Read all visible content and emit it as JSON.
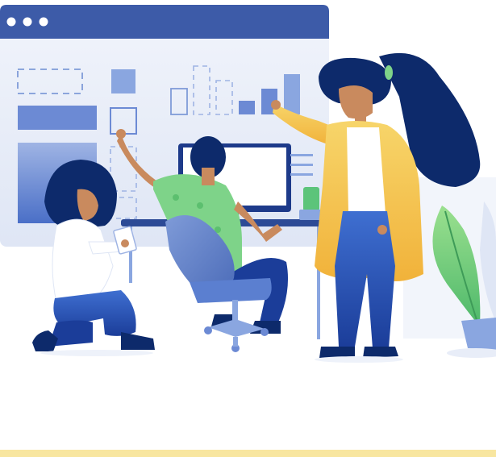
{
  "illustration": {
    "window_dots": 3,
    "colors": {
      "window_bar": "#3d5ba8",
      "window_body": "#e8edf8",
      "accent_blue": "#5b7fd0",
      "dark_navy": "#0d2a6b",
      "shirt_green": "#7ed389",
      "cardigan_yellow": "#f5c24a",
      "skin": "#c98a5e",
      "floor_stripe": "#f8e6a0"
    },
    "icons": [
      "browser-window-icon",
      "monitor-icon",
      "plant-icon",
      "chair-icon"
    ]
  }
}
